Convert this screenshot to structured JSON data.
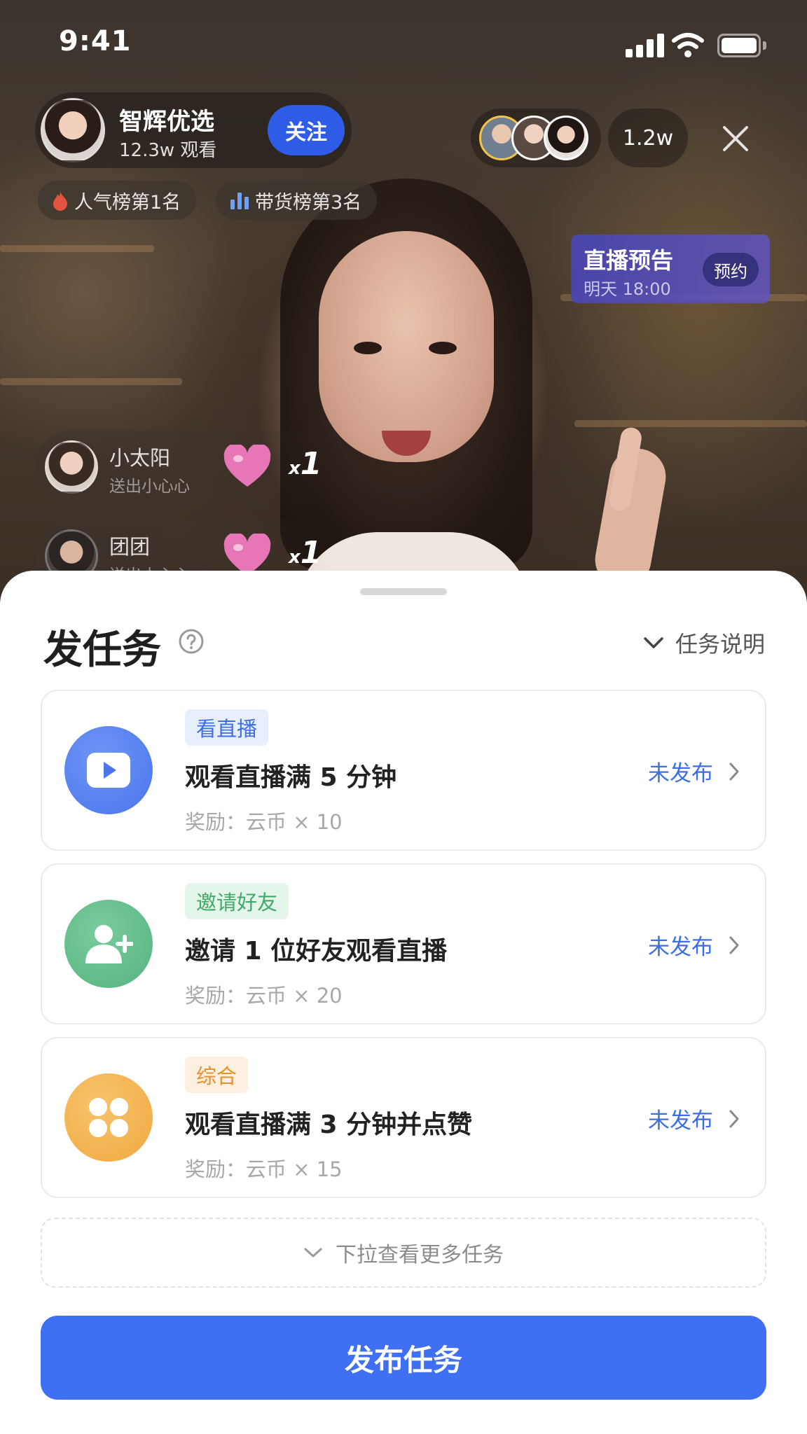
{
  "status_bar": {
    "time": "9:41"
  },
  "host": {
    "name": "智辉优选",
    "viewers": "12.3w 观看",
    "follow_label": "关注"
  },
  "viewer_count": "1.2w",
  "rank_badges": [
    "人气榜第1名",
    "带货榜第3名"
  ],
  "live_preview": {
    "title": "直播预告",
    "time": "明天 18:00",
    "button": "预约"
  },
  "gifts": [
    {
      "name": "小太阳",
      "message": "送出小心心",
      "count_prefix": "x",
      "count": "1"
    },
    {
      "name": "团团",
      "message": "送出小心心",
      "count_prefix": "x",
      "count": "1"
    }
  ],
  "sheet": {
    "title": "发任务",
    "explain_label": "任务说明",
    "tasks": [
      {
        "tag": "看直播",
        "title": "观看直播满 5 分钟",
        "reward": "奖励：云币 × 10",
        "status": "未发布"
      },
      {
        "tag": "邀请好友",
        "title": "邀请 1 位好友观看直播",
        "reward": "奖励：云币 × 20",
        "status": "未发布"
      },
      {
        "tag": "综合",
        "title": "观看直播满 3 分钟并点赞",
        "reward": "奖励：云币 × 15",
        "status": "未发布"
      }
    ],
    "more_label": "下拉查看更多任务",
    "publish_label": "发布任务"
  },
  "colors": {
    "accent": "#3f6ff2",
    "status_blue": "#3d6ee6",
    "watch_icon": "#4f7cf0",
    "invite_icon": "#5cba85",
    "combo_icon": "#f3ad4a"
  },
  "icons": [
    "play-icon",
    "add-user-icon",
    "four-leaf-icon",
    "help-icon",
    "chevron-down-icon",
    "chevron-right-icon",
    "close-icon",
    "flame-icon",
    "bar-chart-icon",
    "heart-icon"
  ]
}
